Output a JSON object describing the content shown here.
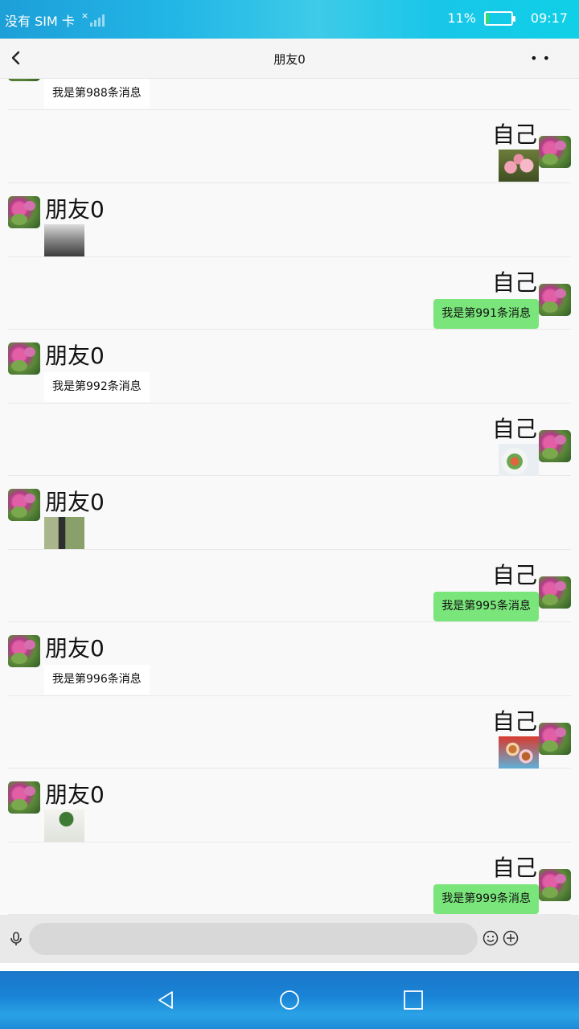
{
  "status_bar": {
    "carrier": "没有 SIM 卡",
    "battery": "11%",
    "battery_level": 0.11,
    "time": "09:17"
  },
  "header": {
    "title": "朋友0"
  },
  "messages": [
    {
      "side": "left",
      "name": "朋友0",
      "text": "我是第988条消息"
    },
    {
      "side": "right",
      "name": "自己",
      "image": "pink-flowers-photo"
    },
    {
      "side": "left",
      "name": "朋友0",
      "image": "street-crowd-photo"
    },
    {
      "side": "right",
      "name": "自己",
      "text": "我是第991条消息"
    },
    {
      "side": "left",
      "name": "朋友0",
      "text": "我是第992条消息"
    },
    {
      "side": "right",
      "name": "自己",
      "image": "food-plate-photo"
    },
    {
      "side": "left",
      "name": "朋友0",
      "image": "tea-table-photo"
    },
    {
      "side": "right",
      "name": "自己",
      "text": "我是第995条消息"
    },
    {
      "side": "left",
      "name": "朋友0",
      "text": "我是第996条消息"
    },
    {
      "side": "right",
      "name": "自己",
      "image": "donuts-photo"
    },
    {
      "side": "left",
      "name": "朋友0",
      "image": "green-plant-photo"
    },
    {
      "side": "right",
      "name": "自己",
      "text": "我是第999条消息"
    }
  ],
  "colors": {
    "self_bubble": "#7ae57a",
    "friend_bubble": "#ffffff"
  },
  "icons": {
    "back": "chevron-left-icon",
    "more": "more-dots-icon",
    "mic": "microphone-icon",
    "emoji": "smiley-icon",
    "plus": "plus-circle-icon",
    "nav_back": "triangle-back-icon",
    "nav_home": "circle-home-icon",
    "nav_recent": "square-recent-icon"
  }
}
